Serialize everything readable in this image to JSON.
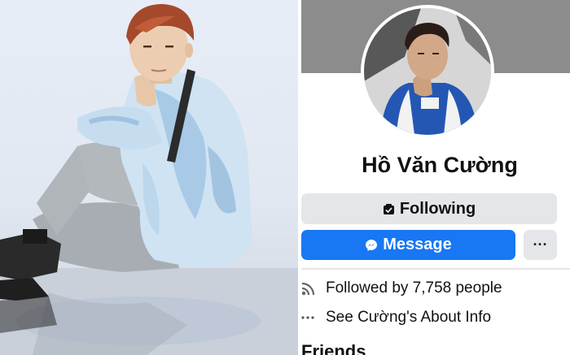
{
  "profile": {
    "name": "Hồ Văn Cường",
    "following_label": "Following",
    "message_label": "Message",
    "more_label": "···",
    "followed_by": "Followed by 7,758 people",
    "about_info": "See Cường's About Info",
    "friends_heading": "Friends"
  },
  "icons": {
    "following": "following-check-icon",
    "message": "messenger-icon",
    "followers": "rss-feed-icon",
    "about": "more-dots-icon"
  },
  "colors": {
    "accent": "#1877f2",
    "button_gray": "#e4e6ea",
    "cover_gray": "#8c8c8c"
  }
}
